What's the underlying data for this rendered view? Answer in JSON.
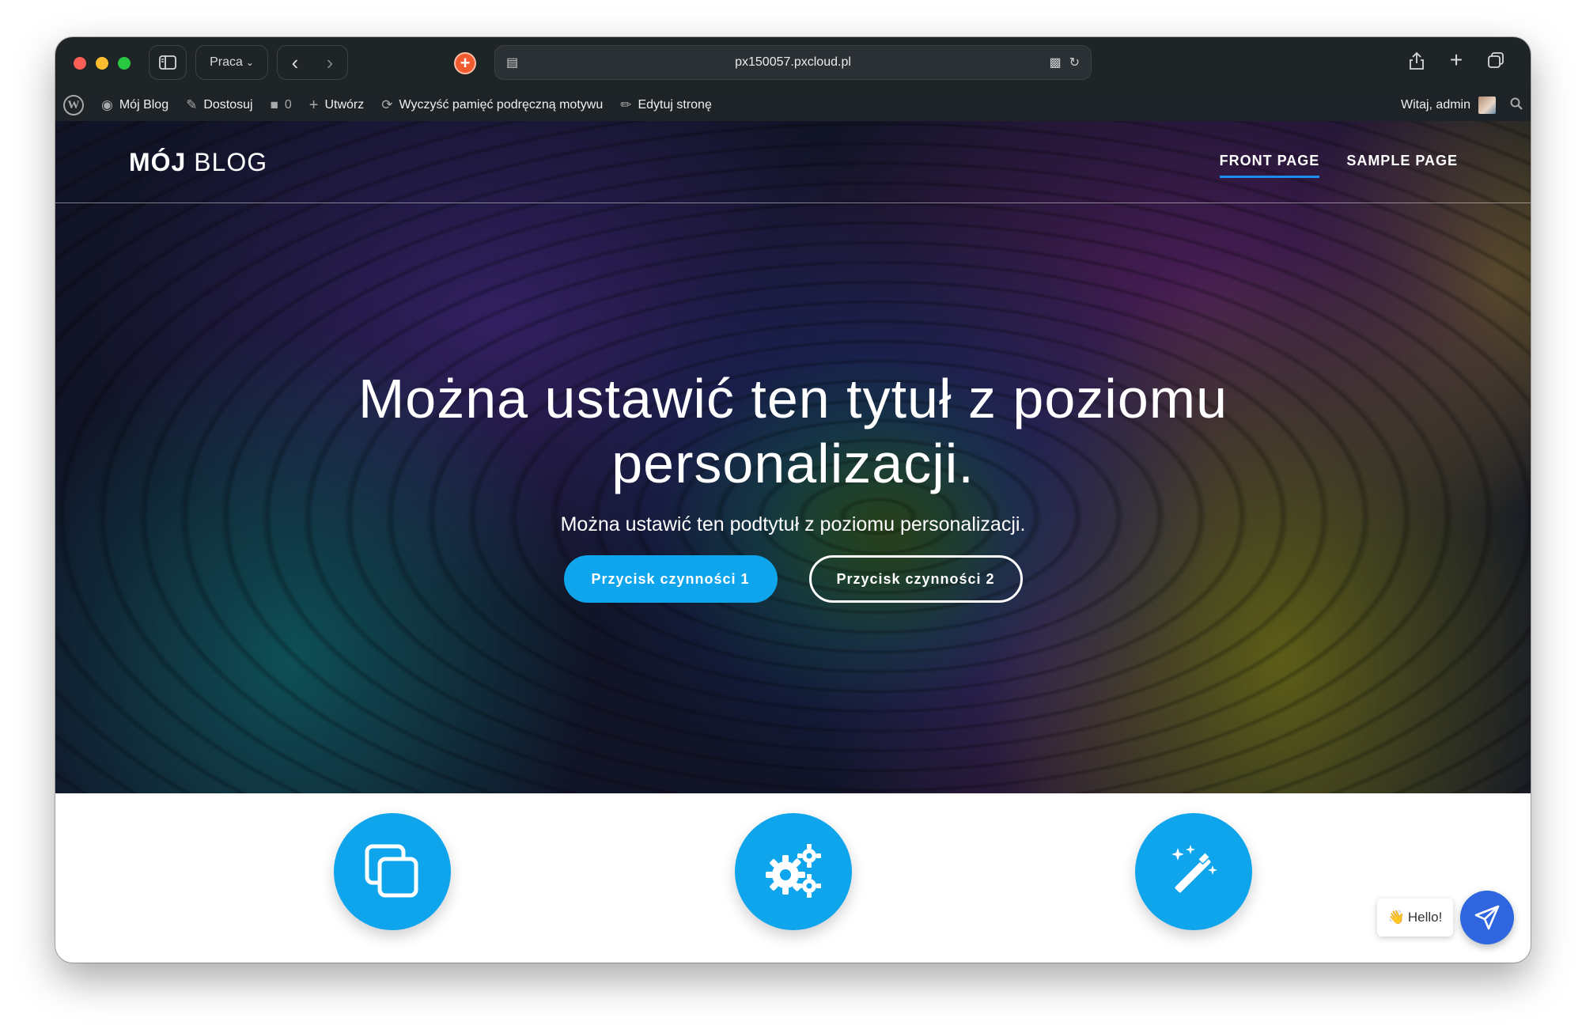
{
  "browser": {
    "profile_label": "Praca",
    "url": "px150057.pxcloud.pl"
  },
  "adminbar": {
    "site_name": "Mój Blog",
    "customize": "Dostosuj",
    "comments_count": "0",
    "new": "Utwórz",
    "clear_cache": "Wyczyść pamięć podręczną motywu",
    "edit_page": "Edytuj stronę",
    "greeting": "Witaj, admin"
  },
  "site": {
    "title_bold": "MÓJ",
    "title_light": "BLOG",
    "nav": [
      {
        "label": "FRONT PAGE",
        "active": true
      },
      {
        "label": "SAMPLE PAGE",
        "active": false
      }
    ]
  },
  "hero": {
    "title": "Można ustawić ten tytuł z poziomu personalizacji.",
    "subtitle": "Można ustawić ten podtytuł z poziomu personalizacji.",
    "button1": "Przycisk czynności 1",
    "button2": "Przycisk czynności 2"
  },
  "features": [
    {
      "icon": "copy-icon"
    },
    {
      "icon": "gears-icon"
    },
    {
      "icon": "magic-wand-icon"
    }
  ],
  "chat": {
    "hello": "Hello!",
    "wave_emoji": "👋"
  },
  "colors": {
    "accent": "#0ea5ec",
    "nav_underline": "#1e8cf0",
    "chat_button": "#2f66e0",
    "adminbar_bg": "#1d2327"
  }
}
